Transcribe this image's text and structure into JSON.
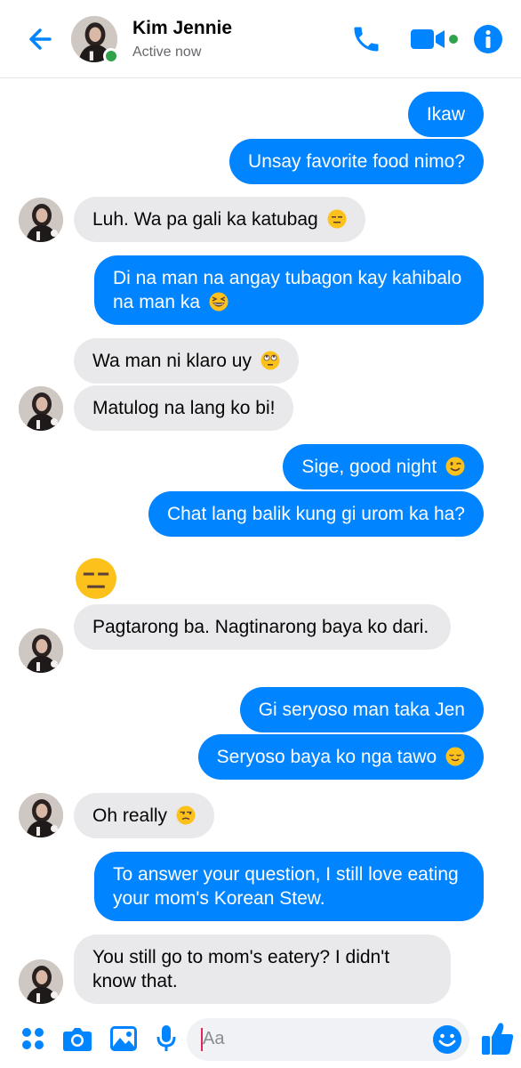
{
  "header": {
    "contact_name": "Kim Jennie",
    "status": "Active now"
  },
  "colors": {
    "accent": "#0084ff",
    "received_bubble": "#e9e9eb",
    "online": "#31a24c"
  },
  "messages": [
    {
      "from": "me",
      "text": "Ikaw"
    },
    {
      "from": "me",
      "text": "Unsay favorite food nimo?"
    },
    {
      "from": "them",
      "text": "Luh. Wa pa gali ka katubag",
      "emoji": "expressionless-face"
    },
    {
      "from": "me",
      "text": "Di na man na angay tubagon kay kahibalo na man ka",
      "emoji": "grinning-squinting-face"
    },
    {
      "from": "them",
      "text": "Wa man ni klaro uy",
      "emoji": "face-with-rolling-eyes"
    },
    {
      "from": "them",
      "text": "Matulog na lang ko bi!"
    },
    {
      "from": "me",
      "text": "Sige, good night",
      "emoji": "winking-face"
    },
    {
      "from": "me",
      "text": "Chat lang balik kung gi urom ka ha?"
    },
    {
      "from": "them",
      "emoji_only": "expressionless-face"
    },
    {
      "from": "them",
      "text": "Pagtarong ba. Nagtinarong baya ko dari."
    },
    {
      "from": "me",
      "text": "Gi seryoso man taka Jen"
    },
    {
      "from": "me",
      "text": "Seryoso baya ko nga tawo",
      "emoji": "relieved-face"
    },
    {
      "from": "them",
      "text": "Oh really",
      "emoji": "unamused-face"
    },
    {
      "from": "me",
      "text": "To answer your question, I still love eating your mom's Korean Stew."
    },
    {
      "from": "them",
      "text": "You still go to mom's eatery? I didn't know that."
    }
  ],
  "composer": {
    "placeholder": "Aa"
  }
}
